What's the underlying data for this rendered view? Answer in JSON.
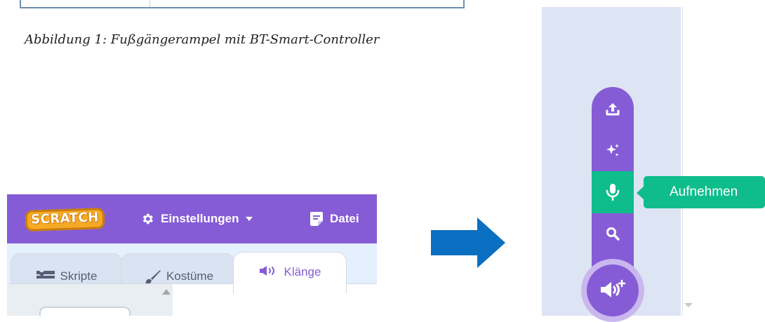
{
  "document": {
    "caption": "Abbildung 1: Fußgängerampel mit BT-Smart-Controller"
  },
  "scratch_editor": {
    "logo_text": "SCRATCH",
    "menu": {
      "settings_label": "Einstellungen",
      "file_label": "Datei"
    },
    "tabs": [
      {
        "label": "Skripte",
        "icon": "code-icon"
      },
      {
        "label": "Kostüme",
        "icon": "brush-icon"
      },
      {
        "label": "Klänge",
        "icon": "speaker-icon",
        "selected": true
      }
    ]
  },
  "sound_menu": {
    "items": [
      {
        "name": "upload",
        "icon": "upload-icon"
      },
      {
        "name": "surprise",
        "icon": "sparkle-icon"
      },
      {
        "name": "record",
        "icon": "microphone-icon",
        "active": true
      },
      {
        "name": "search",
        "icon": "search-icon"
      }
    ],
    "main_button_icon": "add-sound-icon",
    "tooltip": "Aufnehmen"
  },
  "colors": {
    "scratch_purple": "#855cd6",
    "record_green": "#0fbd8c",
    "logo_orange": "#f6a926",
    "arrow_blue": "#0a6fc0",
    "table_border": "#6f8fae"
  }
}
